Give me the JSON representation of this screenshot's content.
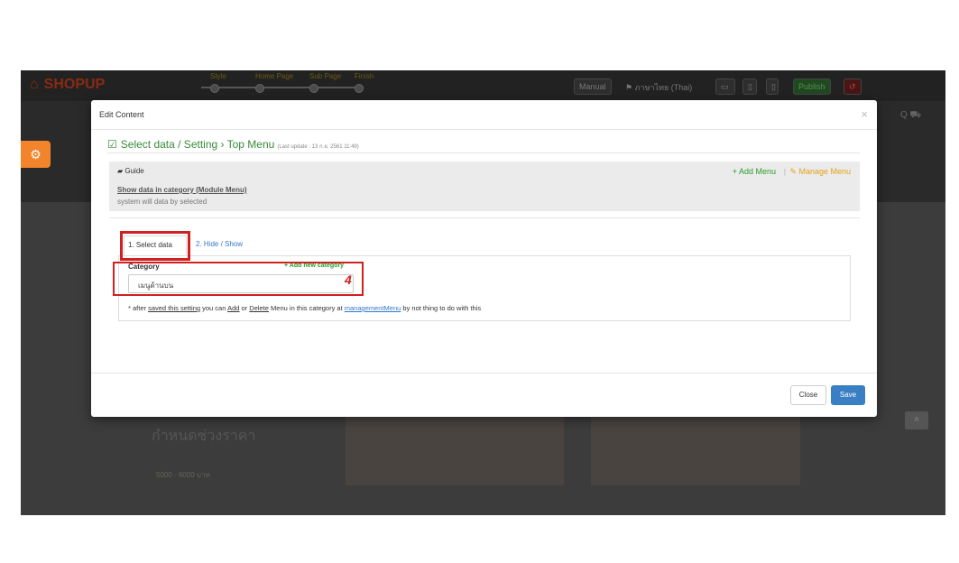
{
  "background": {
    "logo": "SHOPUP",
    "steps": [
      "Style",
      "Home Page",
      "Sub Page",
      "Finish"
    ],
    "manual": "Manual",
    "language": "ภาษาไทย (Thai)",
    "publish": "Publish",
    "price_heading": "กำหนดช่วงราคา",
    "price_range": "5000 - 6000 บาท"
  },
  "modal": {
    "title": "Edit Content",
    "close_x": "×",
    "section": {
      "title": "Select data / Setting › Top Menu",
      "last_update": "(Last update : 13 ก.ย. 2561 11:49)"
    },
    "guide": {
      "label": "Guide",
      "add_menu": "+ Add Menu",
      "separator": "|",
      "manage_menu": "Manage Menu",
      "link": "Show data in category (Module Menu)",
      "description": "system will data by selected"
    },
    "tabs": [
      {
        "label": "1. Select data",
        "active": true
      },
      {
        "label": "2. Hide / Show",
        "active": false
      }
    ],
    "category": {
      "label": "Category",
      "add_new": "+ Add new category",
      "selected": "เมนูด้านบน"
    },
    "note": {
      "prefix": "* after ",
      "saved": "saved this setting",
      "mid1": " you can ",
      "add": "Add",
      "mid2": " or ",
      "delete": "Delete",
      "mid3": " Menu in this category at ",
      "mgmt": "managementMenu",
      "suffix": " by not thing to do with this"
    },
    "buttons": {
      "close": "Close",
      "save": "Save"
    }
  },
  "annotation": {
    "number": "4",
    "color": "#d02020"
  }
}
